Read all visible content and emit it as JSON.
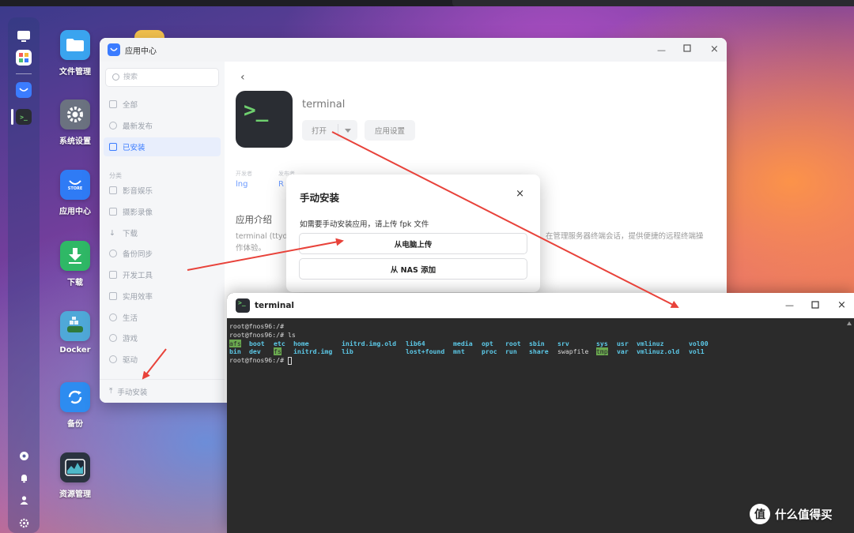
{
  "desktop": {
    "icons": [
      {
        "label": "文件管理",
        "icon": "folder-icon"
      },
      {
        "label": "系统设置",
        "icon": "gear-icon"
      },
      {
        "label": "应用中心",
        "icon": "store-icon",
        "sub": "STORE"
      },
      {
        "label": "下载",
        "icon": "download-icon"
      },
      {
        "label": "Docker",
        "icon": "docker-icon"
      },
      {
        "label": "备份",
        "icon": "backup-icon"
      },
      {
        "label": "资源管理",
        "icon": "resource-monitor-icon"
      }
    ]
  },
  "app_center": {
    "title": "应用中心",
    "search_placeholder": "搜索",
    "nav": [
      {
        "label": "全部"
      },
      {
        "label": "最新发布"
      },
      {
        "label": "已安装",
        "active": true
      }
    ],
    "category_label": "分类",
    "categories": [
      {
        "label": "影音娱乐"
      },
      {
        "label": "摄影录像"
      },
      {
        "label": "下载"
      },
      {
        "label": "备份同步"
      },
      {
        "label": "开发工具"
      },
      {
        "label": "实用效率"
      },
      {
        "label": "生活"
      },
      {
        "label": "游戏"
      },
      {
        "label": "驱动"
      }
    ],
    "manual_install": "手动安装",
    "app": {
      "name": "terminal",
      "icon_glyph": ">_",
      "open_button": "打开",
      "settings_button": "应用设置",
      "meta": [
        {
          "label": "开发者",
          "value": "lng"
        },
        {
          "label": "发布者",
          "value": "R"
        }
      ],
      "intro_title": "应用介绍",
      "intro_text_left": "terminal (ttyd",
      "intro_text_right": "在管理服务器终端会话，提供便捷的远程终端操",
      "intro_text_line2": "作体验。"
    }
  },
  "dialog": {
    "title": "手动安装",
    "close": "×",
    "description": "如需要手动安装应用，请上传 fpk 文件",
    "upload_button": "从电脑上传",
    "nas_button": "从 NAS 添加"
  },
  "terminal": {
    "title": "terminal",
    "icon_glyph": ">_",
    "prompt1": "root@fnos96:/#",
    "prompt2": "root@fnos96:/# ls",
    "prompt3": "root@fnos96:/#",
    "ls_row1": [
      {
        "text": "afs",
        "style": "hl"
      },
      {
        "text": "boot",
        "style": "cy"
      },
      {
        "text": "etc",
        "style": "cy"
      },
      {
        "text": "home",
        "style": "cy"
      },
      {
        "text": "initrd.img.old",
        "style": "cy"
      },
      {
        "text": "lib64",
        "style": "cy"
      },
      {
        "text": "media",
        "style": "cy"
      },
      {
        "text": "opt",
        "style": "cy"
      },
      {
        "text": "root",
        "style": "cy"
      },
      {
        "text": "sbin",
        "style": "cy"
      },
      {
        "text": "srv",
        "style": "cy"
      },
      {
        "text": "sys",
        "style": "cy"
      },
      {
        "text": "usr",
        "style": "cy"
      },
      {
        "text": "vmlinuz",
        "style": "cy"
      },
      {
        "text": "vol00",
        "style": "cy"
      }
    ],
    "ls_row2": [
      {
        "text": "bin",
        "style": "cy"
      },
      {
        "text": "dev",
        "style": "cy"
      },
      {
        "text": "fs",
        "style": "hl"
      },
      {
        "text": "initrd.img",
        "style": "cy"
      },
      {
        "text": "lib",
        "style": "cy"
      },
      {
        "text": "lost+found",
        "style": "cy"
      },
      {
        "text": "mnt",
        "style": "cy"
      },
      {
        "text": "proc",
        "style": "cy"
      },
      {
        "text": "run",
        "style": "cy"
      },
      {
        "text": "share",
        "style": "cy"
      },
      {
        "text": "swapfile",
        "style": "plain"
      },
      {
        "text": "tmp",
        "style": "hl"
      },
      {
        "text": "var",
        "style": "cy"
      },
      {
        "text": "vmlinuz.old",
        "style": "cy"
      },
      {
        "text": "vol1",
        "style": "cy"
      }
    ]
  },
  "watermark": {
    "glyph": "值",
    "text": "什么值得买"
  },
  "colors": {
    "accent": "#3b7cff",
    "arrow": "#e8423a",
    "terminal_bg": "#2b2b2b",
    "terminal_dir": "#5cc9e8",
    "terminal_highlight": "#6aa84f"
  }
}
